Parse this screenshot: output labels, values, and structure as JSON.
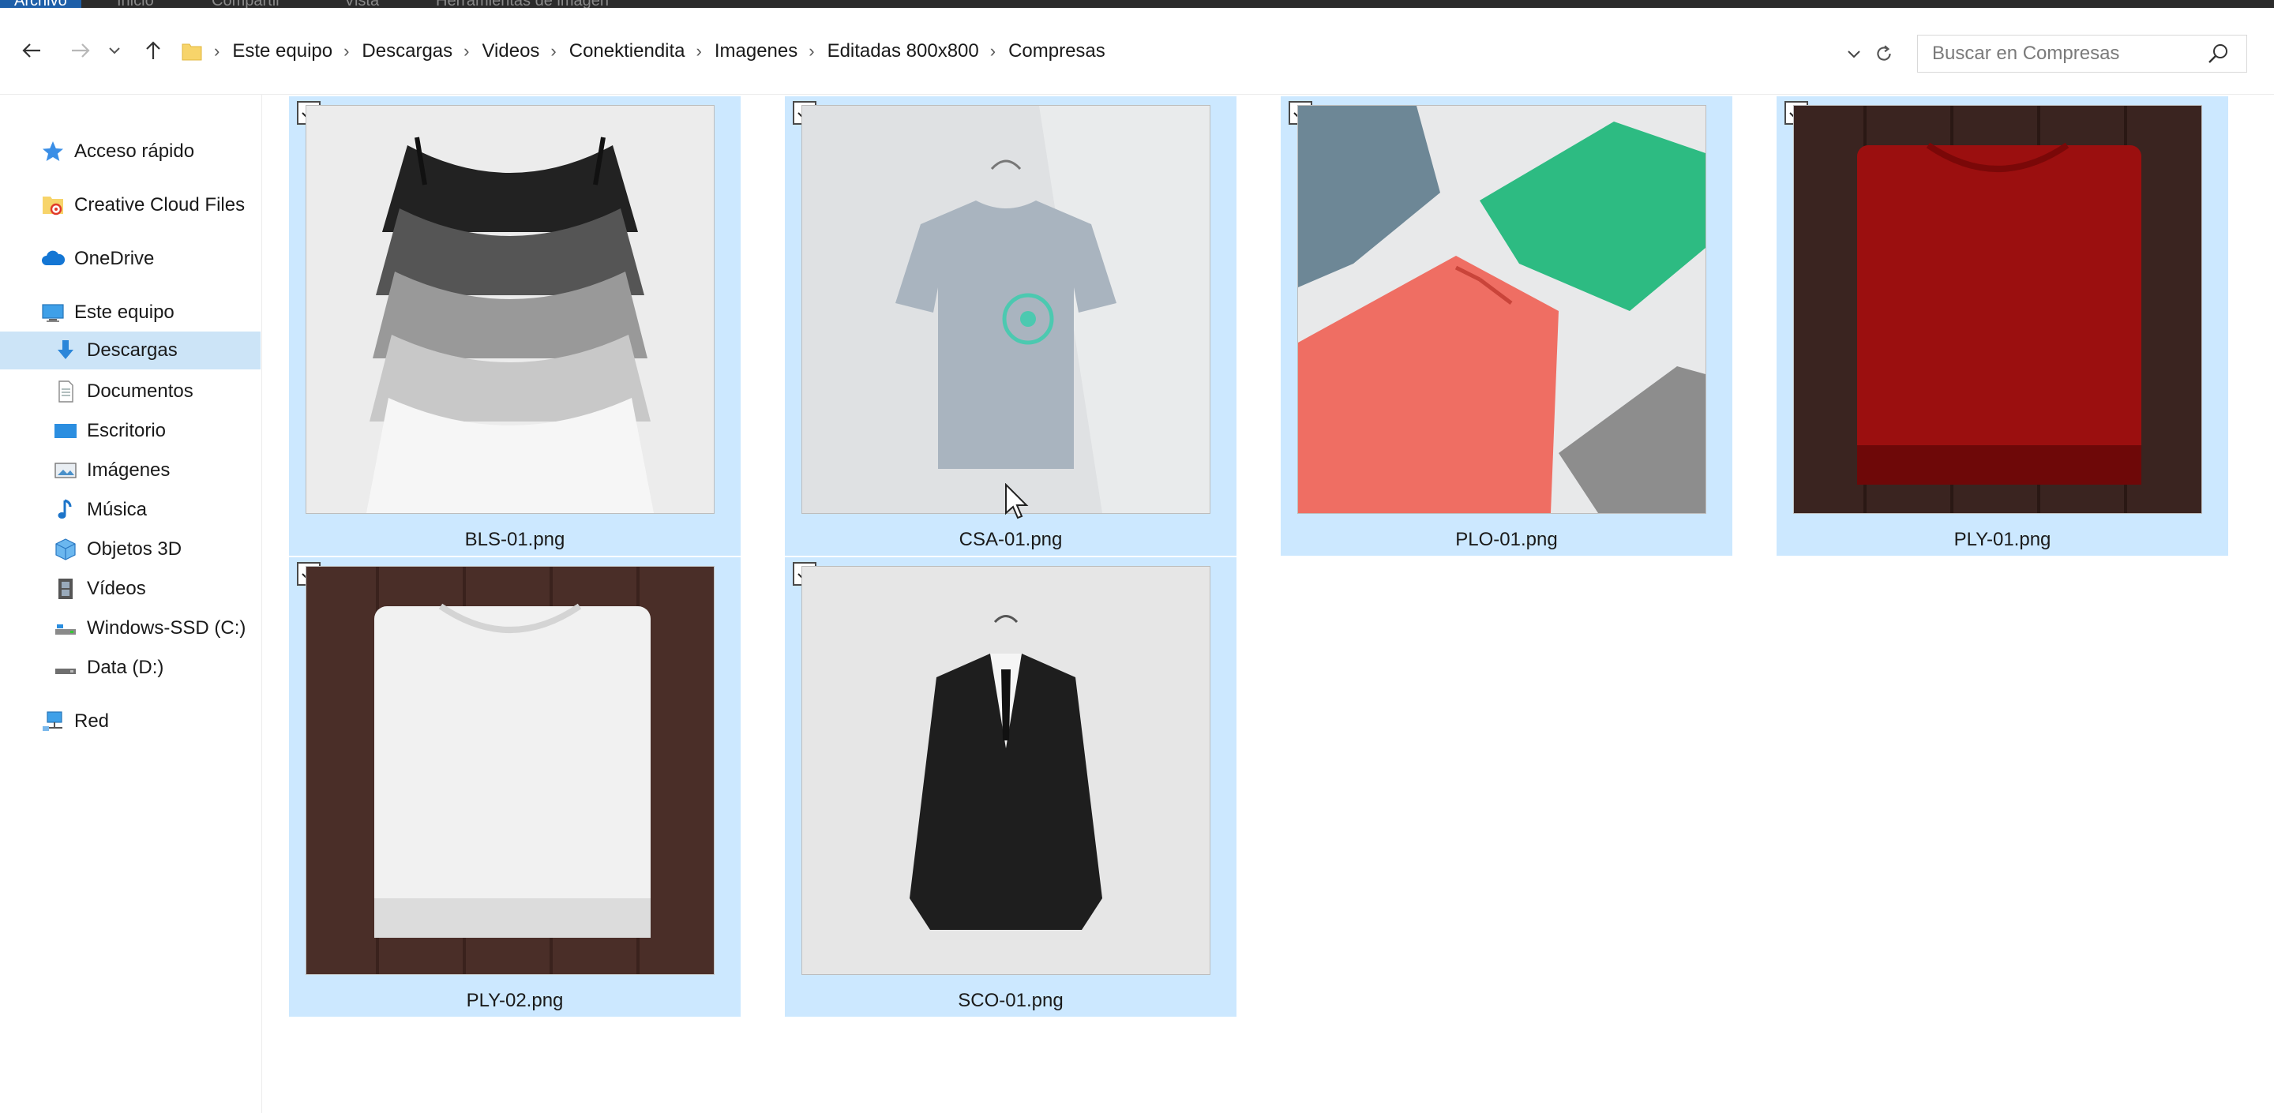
{
  "ribbon": {
    "tabs": [
      "Archivo",
      "Inicio",
      "Compartir",
      "Vista",
      "Herramientas de imagen"
    ]
  },
  "address": {
    "breadcrumbs": [
      "Este equipo",
      "Descargas",
      "Videos",
      "Conektiendita",
      "Imagenes",
      "Editadas 800x800",
      "Compresas"
    ]
  },
  "search": {
    "placeholder": "Buscar en Compresas"
  },
  "nav": {
    "items": [
      {
        "label": "Acceso rápido",
        "icon": "star-icon"
      },
      {
        "label": "Creative Cloud Files",
        "icon": "creative-cloud-folder-icon"
      },
      {
        "label": "OneDrive",
        "icon": "cloud-icon"
      },
      {
        "label": "Este equipo",
        "icon": "computer-icon"
      },
      {
        "label": "Descargas",
        "icon": "download-arrow-icon",
        "selected": true
      },
      {
        "label": "Documentos",
        "icon": "document-icon"
      },
      {
        "label": "Escritorio",
        "icon": "desktop-icon"
      },
      {
        "label": "Imágenes",
        "icon": "pictures-icon"
      },
      {
        "label": "Música",
        "icon": "music-note-icon"
      },
      {
        "label": "Objetos 3D",
        "icon": "cube-icon"
      },
      {
        "label": "Vídeos",
        "icon": "film-icon"
      },
      {
        "label": "Windows-SSD (C:)",
        "icon": "drive-icon"
      },
      {
        "label": "Data (D:)",
        "icon": "drive-icon"
      },
      {
        "label": "Red",
        "icon": "network-icon"
      }
    ]
  },
  "files": [
    {
      "name": "BLS-01.png",
      "checked": true,
      "thumb": "stacked-tank-tops"
    },
    {
      "name": "CSA-01.png",
      "checked": true,
      "thumb": "tshirt-on-hanger"
    },
    {
      "name": "PLO-01.png",
      "checked": true,
      "thumb": "folded-polos"
    },
    {
      "name": "PLY-01.png",
      "checked": true,
      "thumb": "red-folded-shirt"
    },
    {
      "name": "PLY-02.png",
      "checked": true,
      "thumb": "white-folded-shirt"
    },
    {
      "name": "SCO-01.png",
      "checked": true,
      "thumb": "black-blazer"
    }
  ],
  "colors": {
    "selection": "#cce8ff",
    "nav_selected": "#cce4f7",
    "ribbon_active": "#1e5fa8"
  }
}
